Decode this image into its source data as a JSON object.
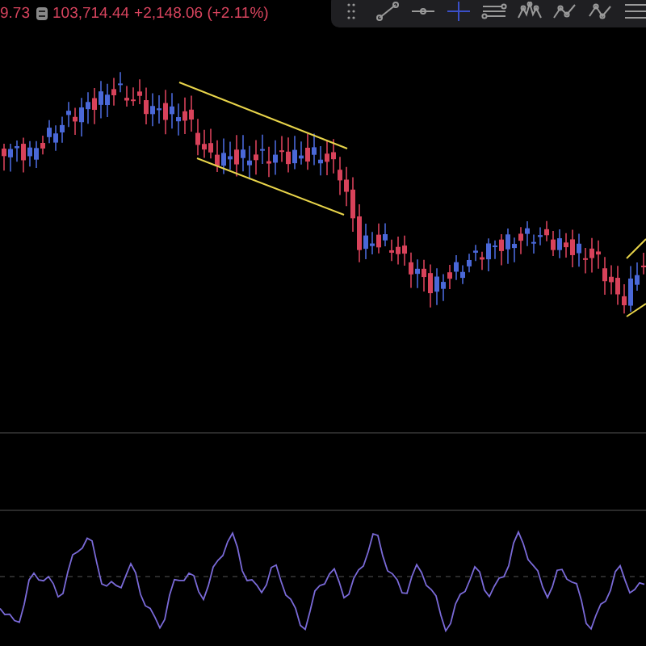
{
  "legend": {
    "values": [
      {
        "text": "9.73"
      },
      {
        "text": "103,714.44",
        "icon": true
      },
      {
        "text": "+2,148.06 (+2.11%)"
      }
    ]
  },
  "toolbar": {
    "tools": [
      {
        "kind": "handle",
        "selected": false
      },
      {
        "kind": "trend",
        "selected": false
      },
      {
        "kind": "hline",
        "selected": false
      },
      {
        "kind": "cross",
        "selected": true
      },
      {
        "kind": "channel",
        "selected": false
      },
      {
        "kind": "pitchfork",
        "selected": false
      },
      {
        "kind": "zigzag",
        "selected": false
      },
      {
        "kind": "path",
        "selected": false
      },
      {
        "kind": "lines",
        "selected": false
      }
    ]
  }
}
